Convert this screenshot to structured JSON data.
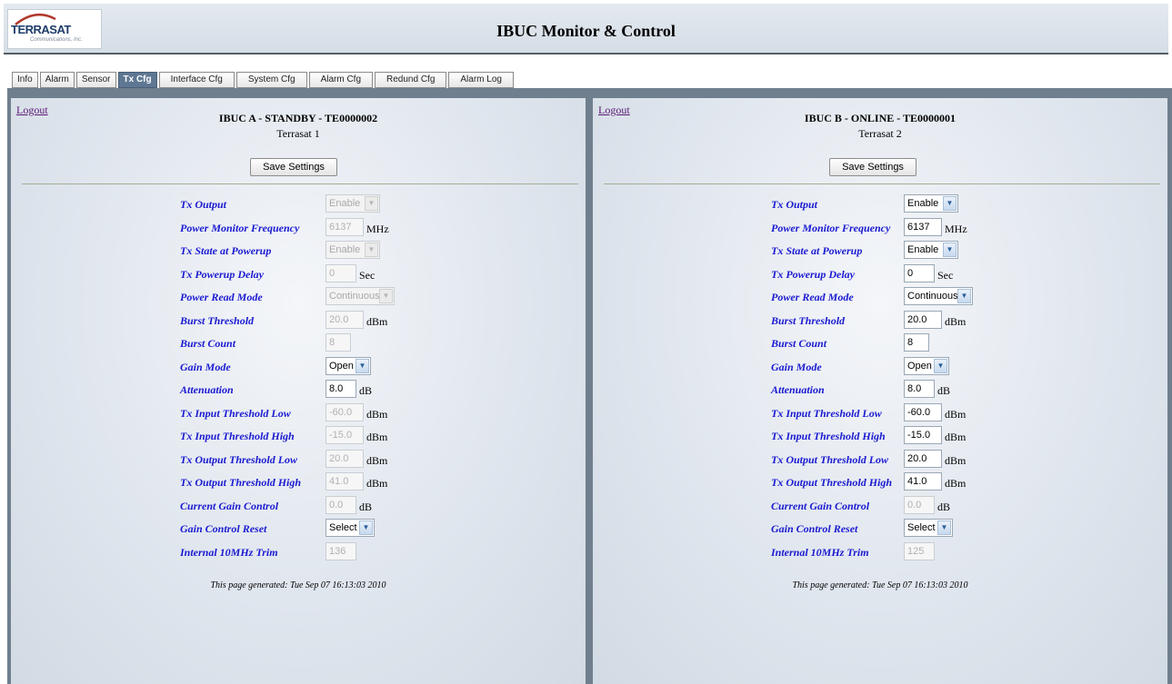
{
  "header": {
    "logo_text": "TERRASAT",
    "logo_sub": "Communications, Inc.",
    "title": "IBUC Monitor & Control"
  },
  "tabs": [
    {
      "label": "Info"
    },
    {
      "label": "Alarm"
    },
    {
      "label": "Sensor"
    },
    {
      "label": "Tx Cfg",
      "active": true
    },
    {
      "label": "Interface Cfg"
    },
    {
      "label": "System Cfg"
    },
    {
      "label": "Alarm Cfg"
    },
    {
      "label": "Redund Cfg"
    },
    {
      "label": "Alarm Log"
    }
  ],
  "colors": {
    "label_blue": "#1a1ad0",
    "active_tab": "#5e7792",
    "frame": "#6f7f8e"
  },
  "panel_a": {
    "logout": "Logout",
    "title": "IBUC A - STANDBY - TE0000002",
    "subtitle": "Terrasat 1",
    "save_label": "Save Settings",
    "fields": {
      "tx_output": {
        "label": "Tx Output",
        "value": "Enable",
        "disabled": true
      },
      "power_monitor_frequency": {
        "label": "Power Monitor Frequency",
        "value": "6137",
        "unit": "MHz",
        "disabled": true
      },
      "tx_state_at_powerup": {
        "label": "Tx State at Powerup",
        "value": "Enable",
        "disabled": true
      },
      "tx_powerup_delay": {
        "label": "Tx Powerup Delay",
        "value": "0",
        "unit": "Sec",
        "disabled": true
      },
      "power_read_mode": {
        "label": "Power Read Mode",
        "value": "Continuous",
        "disabled": true
      },
      "burst_threshold": {
        "label": "Burst Threshold",
        "value": "20.0",
        "unit": "dBm",
        "disabled": true
      },
      "burst_count": {
        "label": "Burst Count",
        "value": "8",
        "disabled": true
      },
      "gain_mode": {
        "label": "Gain Mode",
        "value": "Open",
        "disabled": false
      },
      "attenuation": {
        "label": "Attenuation",
        "value": "8.0",
        "unit": "dB",
        "disabled": false
      },
      "tx_input_threshold_low": {
        "label": "Tx Input Threshold Low",
        "value": "-60.0",
        "unit": "dBm",
        "disabled": true
      },
      "tx_input_threshold_high": {
        "label": "Tx Input Threshold High",
        "value": "-15.0",
        "unit": "dBm",
        "disabled": true
      },
      "tx_output_threshold_low": {
        "label": "Tx Output Threshold Low",
        "value": "20.0",
        "unit": "dBm",
        "disabled": true
      },
      "tx_output_threshold_high": {
        "label": "Tx Output Threshold High",
        "value": "41.0",
        "unit": "dBm",
        "disabled": true
      },
      "current_gain_control": {
        "label": "Current Gain Control",
        "value": "0.0",
        "unit": "dB",
        "disabled": true
      },
      "gain_control_reset": {
        "label": "Gain Control Reset",
        "value": "Select",
        "disabled": false
      },
      "internal_10mhz_trim": {
        "label": "Internal 10MHz Trim",
        "value": "136",
        "disabled": true
      }
    },
    "footer": "This page generated: Tue Sep 07 16:13:03 2010"
  },
  "panel_b": {
    "logout": "Logout",
    "title": "IBUC B - ONLINE - TE0000001",
    "subtitle": "Terrasat 2",
    "save_label": "Save Settings",
    "fields": {
      "tx_output": {
        "label": "Tx Output",
        "value": "Enable",
        "disabled": false
      },
      "power_monitor_frequency": {
        "label": "Power Monitor Frequency",
        "value": "6137",
        "unit": "MHz",
        "disabled": false
      },
      "tx_state_at_powerup": {
        "label": "Tx State at Powerup",
        "value": "Enable",
        "disabled": false
      },
      "tx_powerup_delay": {
        "label": "Tx Powerup Delay",
        "value": "0",
        "unit": "Sec",
        "disabled": false
      },
      "power_read_mode": {
        "label": "Power Read Mode",
        "value": "Continuous",
        "disabled": false
      },
      "burst_threshold": {
        "label": "Burst Threshold",
        "value": "20.0",
        "unit": "dBm",
        "disabled": false
      },
      "burst_count": {
        "label": "Burst Count",
        "value": "8",
        "disabled": false
      },
      "gain_mode": {
        "label": "Gain Mode",
        "value": "Open",
        "disabled": false
      },
      "attenuation": {
        "label": "Attenuation",
        "value": "8.0",
        "unit": "dB",
        "disabled": false
      },
      "tx_input_threshold_low": {
        "label": "Tx Input Threshold Low",
        "value": "-60.0",
        "unit": "dBm",
        "disabled": false
      },
      "tx_input_threshold_high": {
        "label": "Tx Input Threshold High",
        "value": "-15.0",
        "unit": "dBm",
        "disabled": false
      },
      "tx_output_threshold_low": {
        "label": "Tx Output Threshold Low",
        "value": "20.0",
        "unit": "dBm",
        "disabled": false
      },
      "tx_output_threshold_high": {
        "label": "Tx Output Threshold High",
        "value": "41.0",
        "unit": "dBm",
        "disabled": false
      },
      "current_gain_control": {
        "label": "Current Gain Control",
        "value": "0.0",
        "unit": "dB",
        "disabled": true
      },
      "gain_control_reset": {
        "label": "Gain Control Reset",
        "value": "Select",
        "disabled": false
      },
      "internal_10mhz_trim": {
        "label": "Internal 10MHz Trim",
        "value": "125",
        "disabled": true
      }
    },
    "footer": "This page generated: Tue Sep 07 16:13:03 2010"
  }
}
